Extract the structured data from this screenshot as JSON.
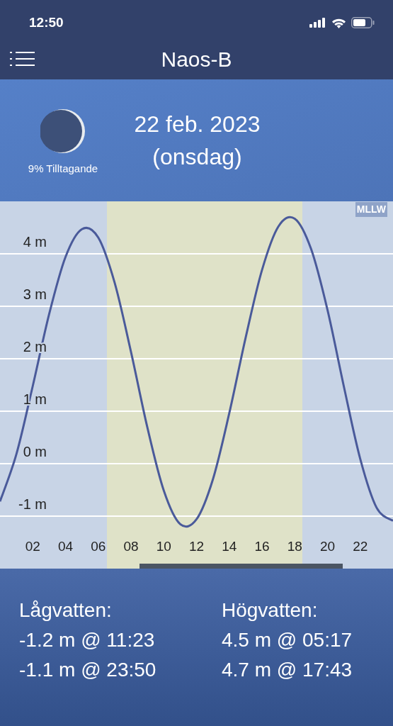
{
  "status_bar": {
    "time": "12:50"
  },
  "nav": {
    "title": "Naos-B"
  },
  "header": {
    "moon_phase": "9% Tilltagande",
    "date": "22 feb. 2023",
    "weekday": "(onsdag)"
  },
  "datum": "MLLW",
  "chart_data": {
    "type": "line",
    "xlim": [
      0,
      24
    ],
    "ylim": [
      -2,
      5
    ],
    "grid": true,
    "x": [
      0,
      1,
      2,
      3,
      4,
      5,
      6,
      7,
      8,
      9,
      10,
      11,
      12,
      13,
      14,
      15,
      16,
      17,
      18,
      19,
      20,
      21,
      22,
      23,
      24
    ],
    "series": [
      {
        "color": "#4a5a9a",
        "values": [
          -0.72,
          0.18,
          1.48,
          2.85,
          3.94,
          4.47,
          4.31,
          3.45,
          2.13,
          0.69,
          -0.51,
          -1.15,
          -1.06,
          -0.3,
          0.96,
          2.4,
          3.69,
          4.52,
          4.67,
          4.09,
          2.93,
          1.47,
          0.09,
          -0.84,
          -1.09
        ]
      }
    ],
    "yticks": [
      {
        "value": 4,
        "label": "4 m"
      },
      {
        "value": 3,
        "label": "3 m"
      },
      {
        "value": 2,
        "label": "2 m"
      },
      {
        "value": 1,
        "label": "1 m"
      },
      {
        "value": 0,
        "label": "0 m"
      },
      {
        "value": -1,
        "label": "-1 m"
      }
    ],
    "xticks": [
      {
        "value": 2,
        "label": "02"
      },
      {
        "value": 4,
        "label": "04"
      },
      {
        "value": 6,
        "label": "06"
      },
      {
        "value": 8,
        "label": "08"
      },
      {
        "value": 10,
        "label": "10"
      },
      {
        "value": 12,
        "label": "12"
      },
      {
        "value": 14,
        "label": "14"
      },
      {
        "value": 16,
        "label": "16"
      },
      {
        "value": 18,
        "label": "18"
      },
      {
        "value": 20,
        "label": "20"
      },
      {
        "value": 22,
        "label": "22"
      }
    ]
  },
  "tides": [
    {
      "heading": "Lågvatten:",
      "entries": [
        "-1.2 m @ 11:23",
        "-1.1 m @ 23:50"
      ]
    },
    {
      "heading": "Högvatten:",
      "entries": [
        "4.5 m @ 05:17",
        "4.7 m @ 17:43"
      ]
    }
  ]
}
